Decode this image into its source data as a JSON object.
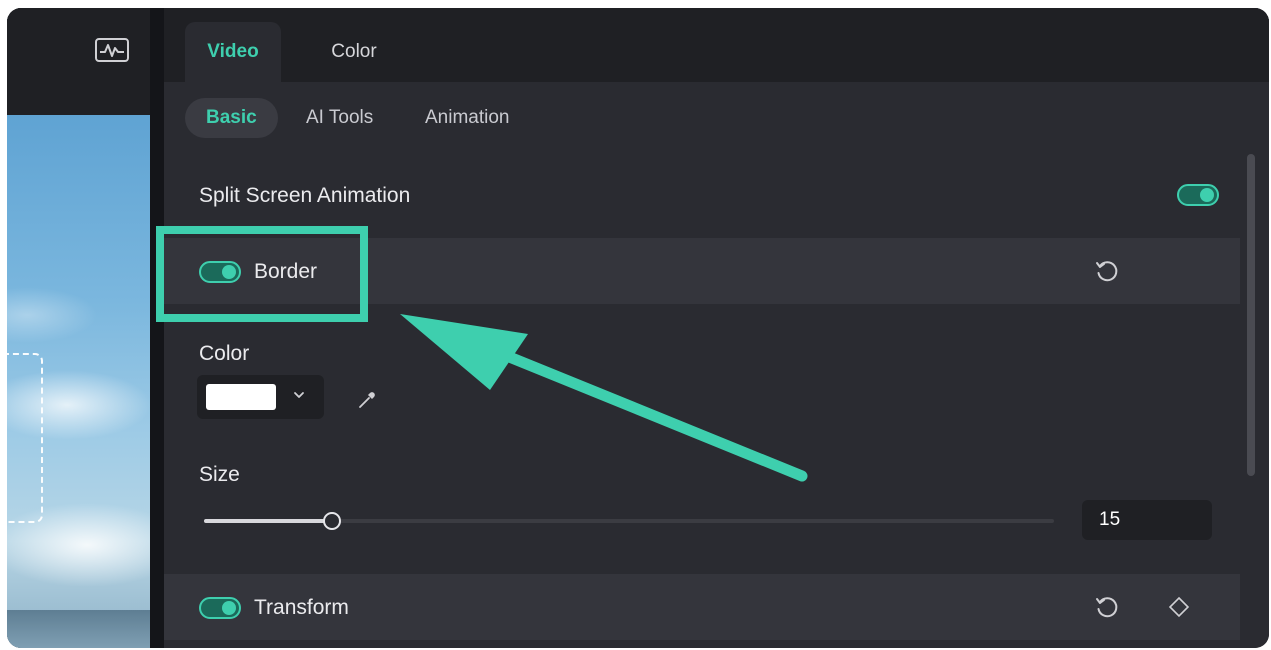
{
  "tabs": [
    {
      "label": "Video",
      "active": true
    },
    {
      "label": "Color",
      "active": false
    }
  ],
  "subtabs": [
    {
      "label": "Basic",
      "active": true
    },
    {
      "label": "AI Tools",
      "active": false
    },
    {
      "label": "Animation",
      "active": false
    }
  ],
  "split_screen": {
    "label": "Split Screen Animation",
    "enabled": true
  },
  "border": {
    "label": "Border",
    "enabled": true,
    "color_label": "Color",
    "color_value": "#ffffff",
    "size_label": "Size",
    "size_value": "15",
    "size_fraction": 0.15
  },
  "transform": {
    "label": "Transform",
    "enabled": true
  },
  "colors": {
    "accent": "#3ecfae",
    "panel": "#2a2b31",
    "header": "#1f2024"
  },
  "icons": [
    "waveform-icon",
    "reset-icon",
    "chevron-down-icon",
    "eyedropper-icon",
    "keyframe-diamond-icon"
  ]
}
